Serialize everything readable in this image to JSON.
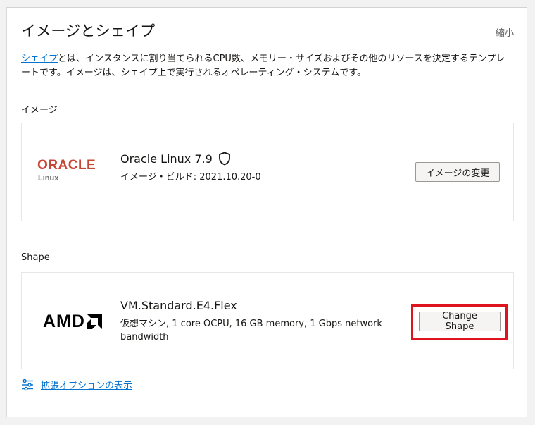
{
  "header": {
    "title": "イメージとシェイプ",
    "collapse_label": "縮小"
  },
  "description": {
    "link_text": "シェイプ",
    "text": "とは、インスタンスに割り当てられるCPU数、メモリー・サイズおよびその他のリソースを決定するテンプレートです。イメージは、シェイプ上で実行されるオペレーティング・システムです。"
  },
  "image_section": {
    "label": "イメージ",
    "logo_main": "ORACLE",
    "logo_sub": "Linux",
    "name": "Oracle Linux 7.9",
    "build": "イメージ・ビルド: 2021.10.20-0",
    "change_button": "イメージの変更",
    "icon": "shield-icon"
  },
  "shape_section": {
    "label": "Shape",
    "logo_main": "AMD",
    "name": "VM.Standard.E4.Flex",
    "details_line1": "仮想マシン, 1 core OCPU, 16 GB memory, 1 Gbps network",
    "details_line2": "bandwidth",
    "change_button": "Change Shape"
  },
  "advanced": {
    "label": "拡張オプションの表示",
    "icon": "sliders-icon"
  },
  "colors": {
    "oracle_red": "#c74634",
    "link_blue": "#0572ce",
    "highlight_red": "#e0141f"
  }
}
